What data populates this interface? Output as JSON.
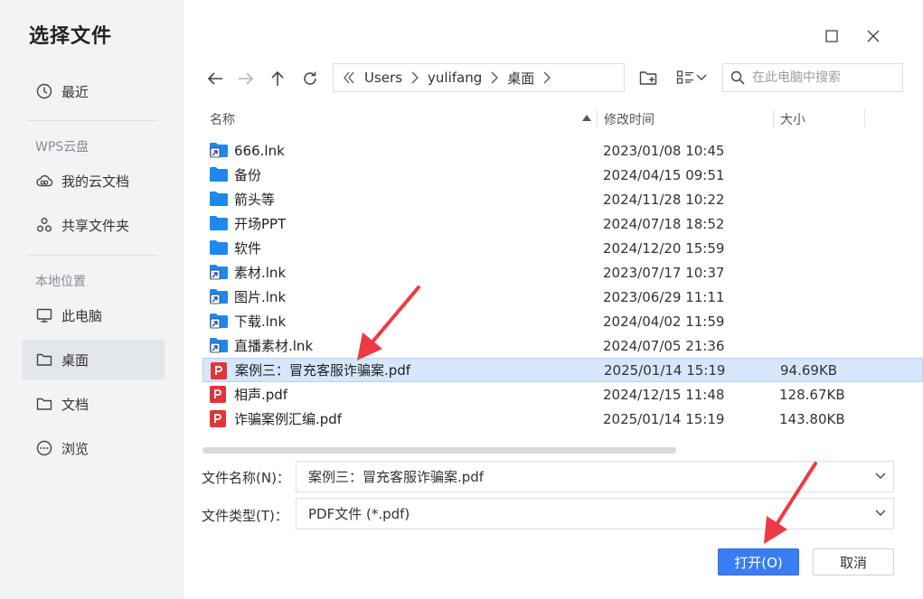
{
  "dialog": {
    "title": "选择文件"
  },
  "sidebar": {
    "recent": {
      "label": "最近",
      "icon": "clock-icon"
    },
    "cloud_section": "WPS云盘",
    "my_cloud": {
      "label": "我的云文档",
      "icon": "cloud-icon"
    },
    "shared": {
      "label": "共享文件夹",
      "icon": "share-icon"
    },
    "local_section": "本地位置",
    "this_pc": {
      "label": "此电脑",
      "icon": "monitor-icon"
    },
    "desktop": {
      "label": "桌面",
      "icon": "folder-icon",
      "active": true
    },
    "documents": {
      "label": "文档",
      "icon": "folder-icon"
    },
    "browse": {
      "label": "浏览",
      "icon": "more-icon"
    }
  },
  "toolbar": {
    "breadcrumb": [
      "Users",
      "yulifang",
      "桌面"
    ],
    "search_placeholder": "在此电脑中搜索"
  },
  "columns": {
    "name": "名称",
    "modified": "修改时间",
    "size": "大小"
  },
  "files": [
    {
      "name": "666.lnk",
      "date": "2023/01/08 10:45",
      "size": "",
      "type": "shortcut"
    },
    {
      "name": "备份",
      "date": "2024/04/15 09:51",
      "size": "",
      "type": "folder"
    },
    {
      "name": "箭头等",
      "date": "2024/11/28 10:22",
      "size": "",
      "type": "folder"
    },
    {
      "name": "开场PPT",
      "date": "2024/07/18 18:52",
      "size": "",
      "type": "folder"
    },
    {
      "name": "软件",
      "date": "2024/12/20 15:59",
      "size": "",
      "type": "folder"
    },
    {
      "name": "素材.lnk",
      "date": "2023/07/17 10:37",
      "size": "",
      "type": "shortcut"
    },
    {
      "name": "图片.lnk",
      "date": "2023/06/29 11:11",
      "size": "",
      "type": "shortcut"
    },
    {
      "name": "下载.lnk",
      "date": "2024/04/02 11:59",
      "size": "",
      "type": "shortcut"
    },
    {
      "name": "直播素材.lnk",
      "date": "2024/07/05 21:36",
      "size": "",
      "type": "shortcut"
    },
    {
      "name": "案例三：冒充客服诈骗案.pdf",
      "date": "2025/01/14 15:19",
      "size": "94.69KB",
      "type": "pdf",
      "selected": true
    },
    {
      "name": "相声.pdf",
      "date": "2024/12/15 11:48",
      "size": "128.67KB",
      "type": "pdf"
    },
    {
      "name": "诈骗案例汇编.pdf",
      "date": "2025/01/14 15:19",
      "size": "143.80KB",
      "type": "pdf"
    }
  ],
  "footer": {
    "filename_label": "文件名称(N)：",
    "filename_value": "案例三：冒充客服诈骗案.pdf",
    "filetype_label": "文件类型(T)：",
    "filetype_value": "PDF文件 (*.pdf)",
    "open_label": "打开(O)",
    "cancel_label": "取消"
  },
  "colors": {
    "accent": "#3a7df0",
    "folder": "#1e88f0",
    "pdf": "#e0353b",
    "selection": "#d6e6fb",
    "annotation_arrow": "#ee3a45"
  }
}
